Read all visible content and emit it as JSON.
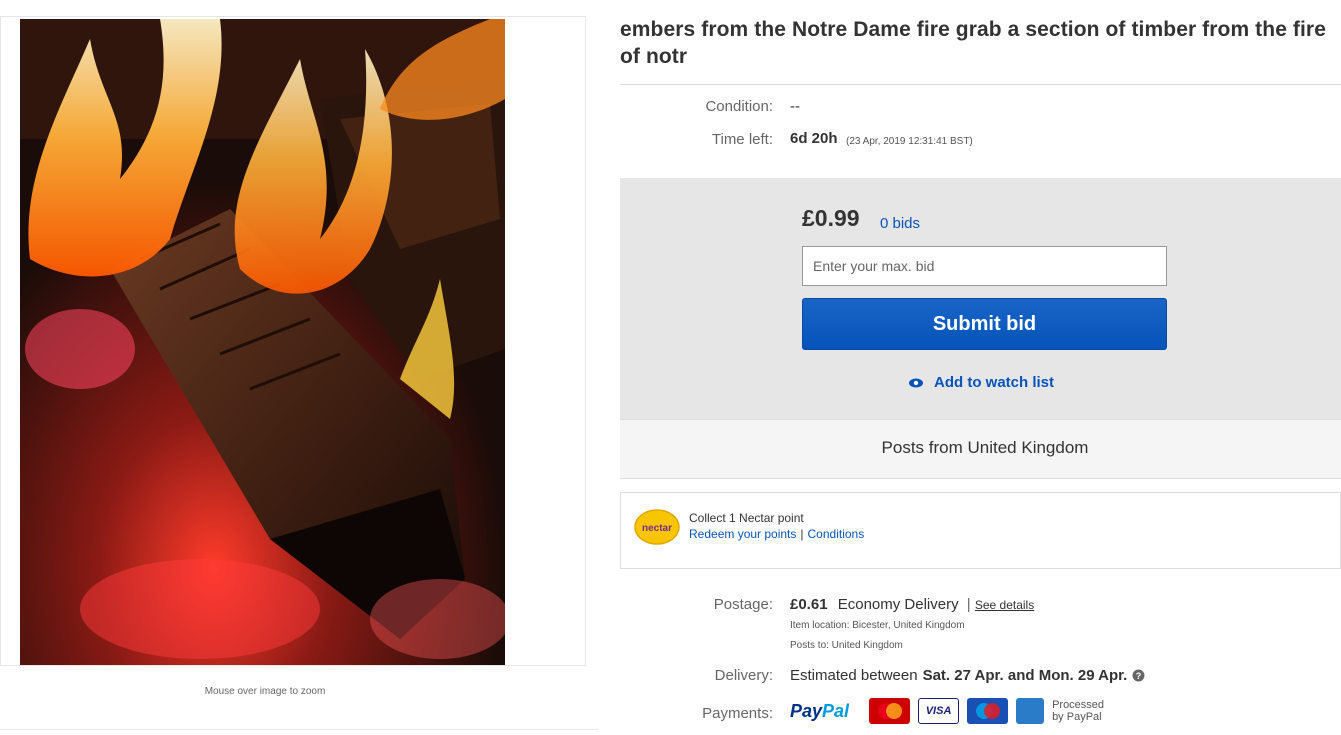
{
  "listing": {
    "title": "embers from  the  Notre Dame fire grab a section of timber from the fire of notr",
    "condition_label": "Condition:",
    "condition_value": "--",
    "time_left_label": "Time left:",
    "time_left_value": "6d 20h",
    "time_left_detail": "(23 Apr, 2019   12:31:41 BST)"
  },
  "image": {
    "zoom_hint": "Mouse over image to zoom"
  },
  "bid": {
    "price": "£0.99",
    "bids_count": "0 bids",
    "input_placeholder": "Enter your max. bid",
    "submit_label": "Submit bid",
    "watch_label": "Add to watch list",
    "posts_from": "Posts from United Kingdom"
  },
  "nectar": {
    "logo_text": "nectar",
    "collect_text": "Collect 1 Nectar point",
    "redeem_link": "Redeem your points",
    "separator": "|",
    "conditions_link": "Conditions"
  },
  "shipping": {
    "postage_label": "Postage:",
    "postage_price": "£0.61",
    "postage_method": "Economy Delivery",
    "separator": "|",
    "see_details": "See details",
    "item_location": "Item location:  Bicester, United Kingdom",
    "posts_to": "Posts to:  United Kingdom",
    "delivery_label": "Delivery:",
    "delivery_prefix": "Estimated between",
    "delivery_dates": "Sat. 27 Apr. and Mon. 29 Apr.",
    "payments_label": "Payments:",
    "paypal_pay": "Pay",
    "paypal_pal": "Pal",
    "card_visa": "VISA",
    "processed_line1": "Processed",
    "processed_line2": "by PayPal"
  },
  "colors": {
    "link_blue": "#0654ba",
    "bid_panel": "#e6e6e6",
    "submit_blue": "#0654ba",
    "nectar_yellow": "#f7c600"
  }
}
